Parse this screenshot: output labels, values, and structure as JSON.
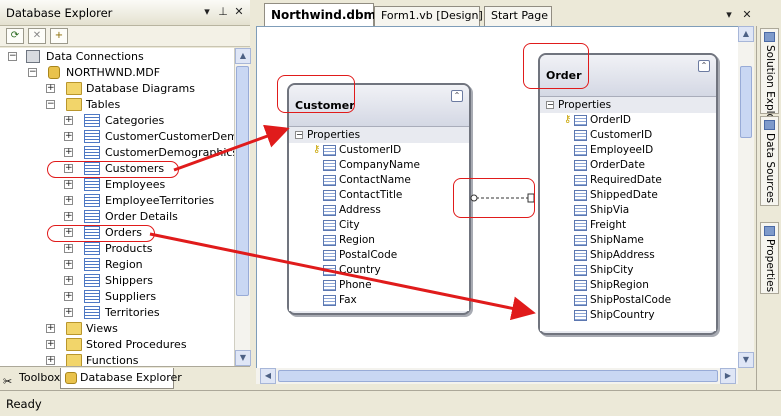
{
  "explorer": {
    "title": "Database Explorer",
    "header_icons": [
      "dropdown-icon",
      "pin-icon",
      "close-icon"
    ],
    "toolbar_icons": [
      "refresh-icon",
      "stop-icon",
      "add-connection-icon"
    ],
    "tree": {
      "data_connections": "Data Connections",
      "database": "NORTHWND.MDF",
      "database_diagrams": "Database Diagrams",
      "tables": "Tables",
      "table_items": [
        "Categories",
        "CustomerCustomerDemo",
        "CustomerDemographics",
        "Customers",
        "Employees",
        "EmployeeTerritories",
        "Order Details",
        "Orders",
        "Products",
        "Region",
        "Shippers",
        "Suppliers",
        "Territories"
      ],
      "views": "Views",
      "stored_procedures": "Stored Procedures",
      "functions": "Functions"
    },
    "bottom_tabs": [
      "Toolbox",
      "Database Explorer"
    ]
  },
  "document_tabs": [
    "Northwind.dbml*",
    "Form1.vb [Design]",
    "Start Page"
  ],
  "designer": {
    "customer": {
      "name": "Customer",
      "section": "Properties",
      "properties": [
        "CustomerID",
        "CompanyName",
        "ContactName",
        "ContactTitle",
        "Address",
        "City",
        "Region",
        "PostalCode",
        "Country",
        "Phone",
        "Fax"
      ]
    },
    "order": {
      "name": "Order",
      "section": "Properties",
      "properties": [
        "OrderID",
        "CustomerID",
        "EmployeeID",
        "OrderDate",
        "RequiredDate",
        "ShippedDate",
        "ShipVia",
        "Freight",
        "ShipName",
        "ShipAddress",
        "ShipCity",
        "ShipRegion",
        "ShipPostalCode",
        "ShipCountry"
      ]
    }
  },
  "right_tabs": [
    "Solution Explorer",
    "Data Sources",
    "Properties"
  ],
  "status": "Ready",
  "colors": {
    "annotation": "#e01b1b",
    "accent": "#316ac5"
  }
}
